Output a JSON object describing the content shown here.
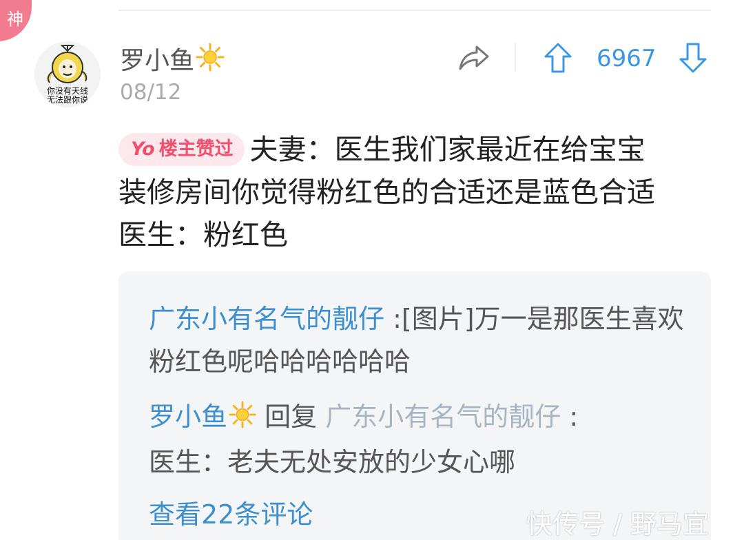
{
  "badge": {
    "label": "神"
  },
  "avatar": {
    "caption_line1": "你没有天线",
    "caption_line2": "无法跟你说"
  },
  "post": {
    "username": "罗小鱼",
    "date": "08/12",
    "vote_count": "6967",
    "op_badge_prefix": "Yo",
    "op_badge_label": "楼主赞过",
    "content_lines": [
      "夫妻：医生我们家最近在给宝宝",
      "装修房间你觉得粉红色的合适还是蓝色合适",
      "医生：粉红色"
    ]
  },
  "replies": [
    {
      "author": "广东小有名气的靓仔",
      "separator": ":",
      "text": "[图片]万一是那医生喜欢粉红色呢哈哈哈哈哈哈"
    },
    {
      "author": "罗小鱼",
      "reply_word": "回复",
      "target": "广东小有名气的靓仔",
      "separator": ":",
      "text": "医生：老夫无处安放的少女心哪"
    }
  ],
  "view_comments": "查看22条评论",
  "watermark": "快传号 / 野马宜",
  "icons": [
    "share-icon",
    "upvote-icon",
    "downvote-icon",
    "sun-icon"
  ],
  "colors": {
    "accent": "#3d8fce",
    "badge": "#f27c8f",
    "op_badge": "#f0506e"
  }
}
